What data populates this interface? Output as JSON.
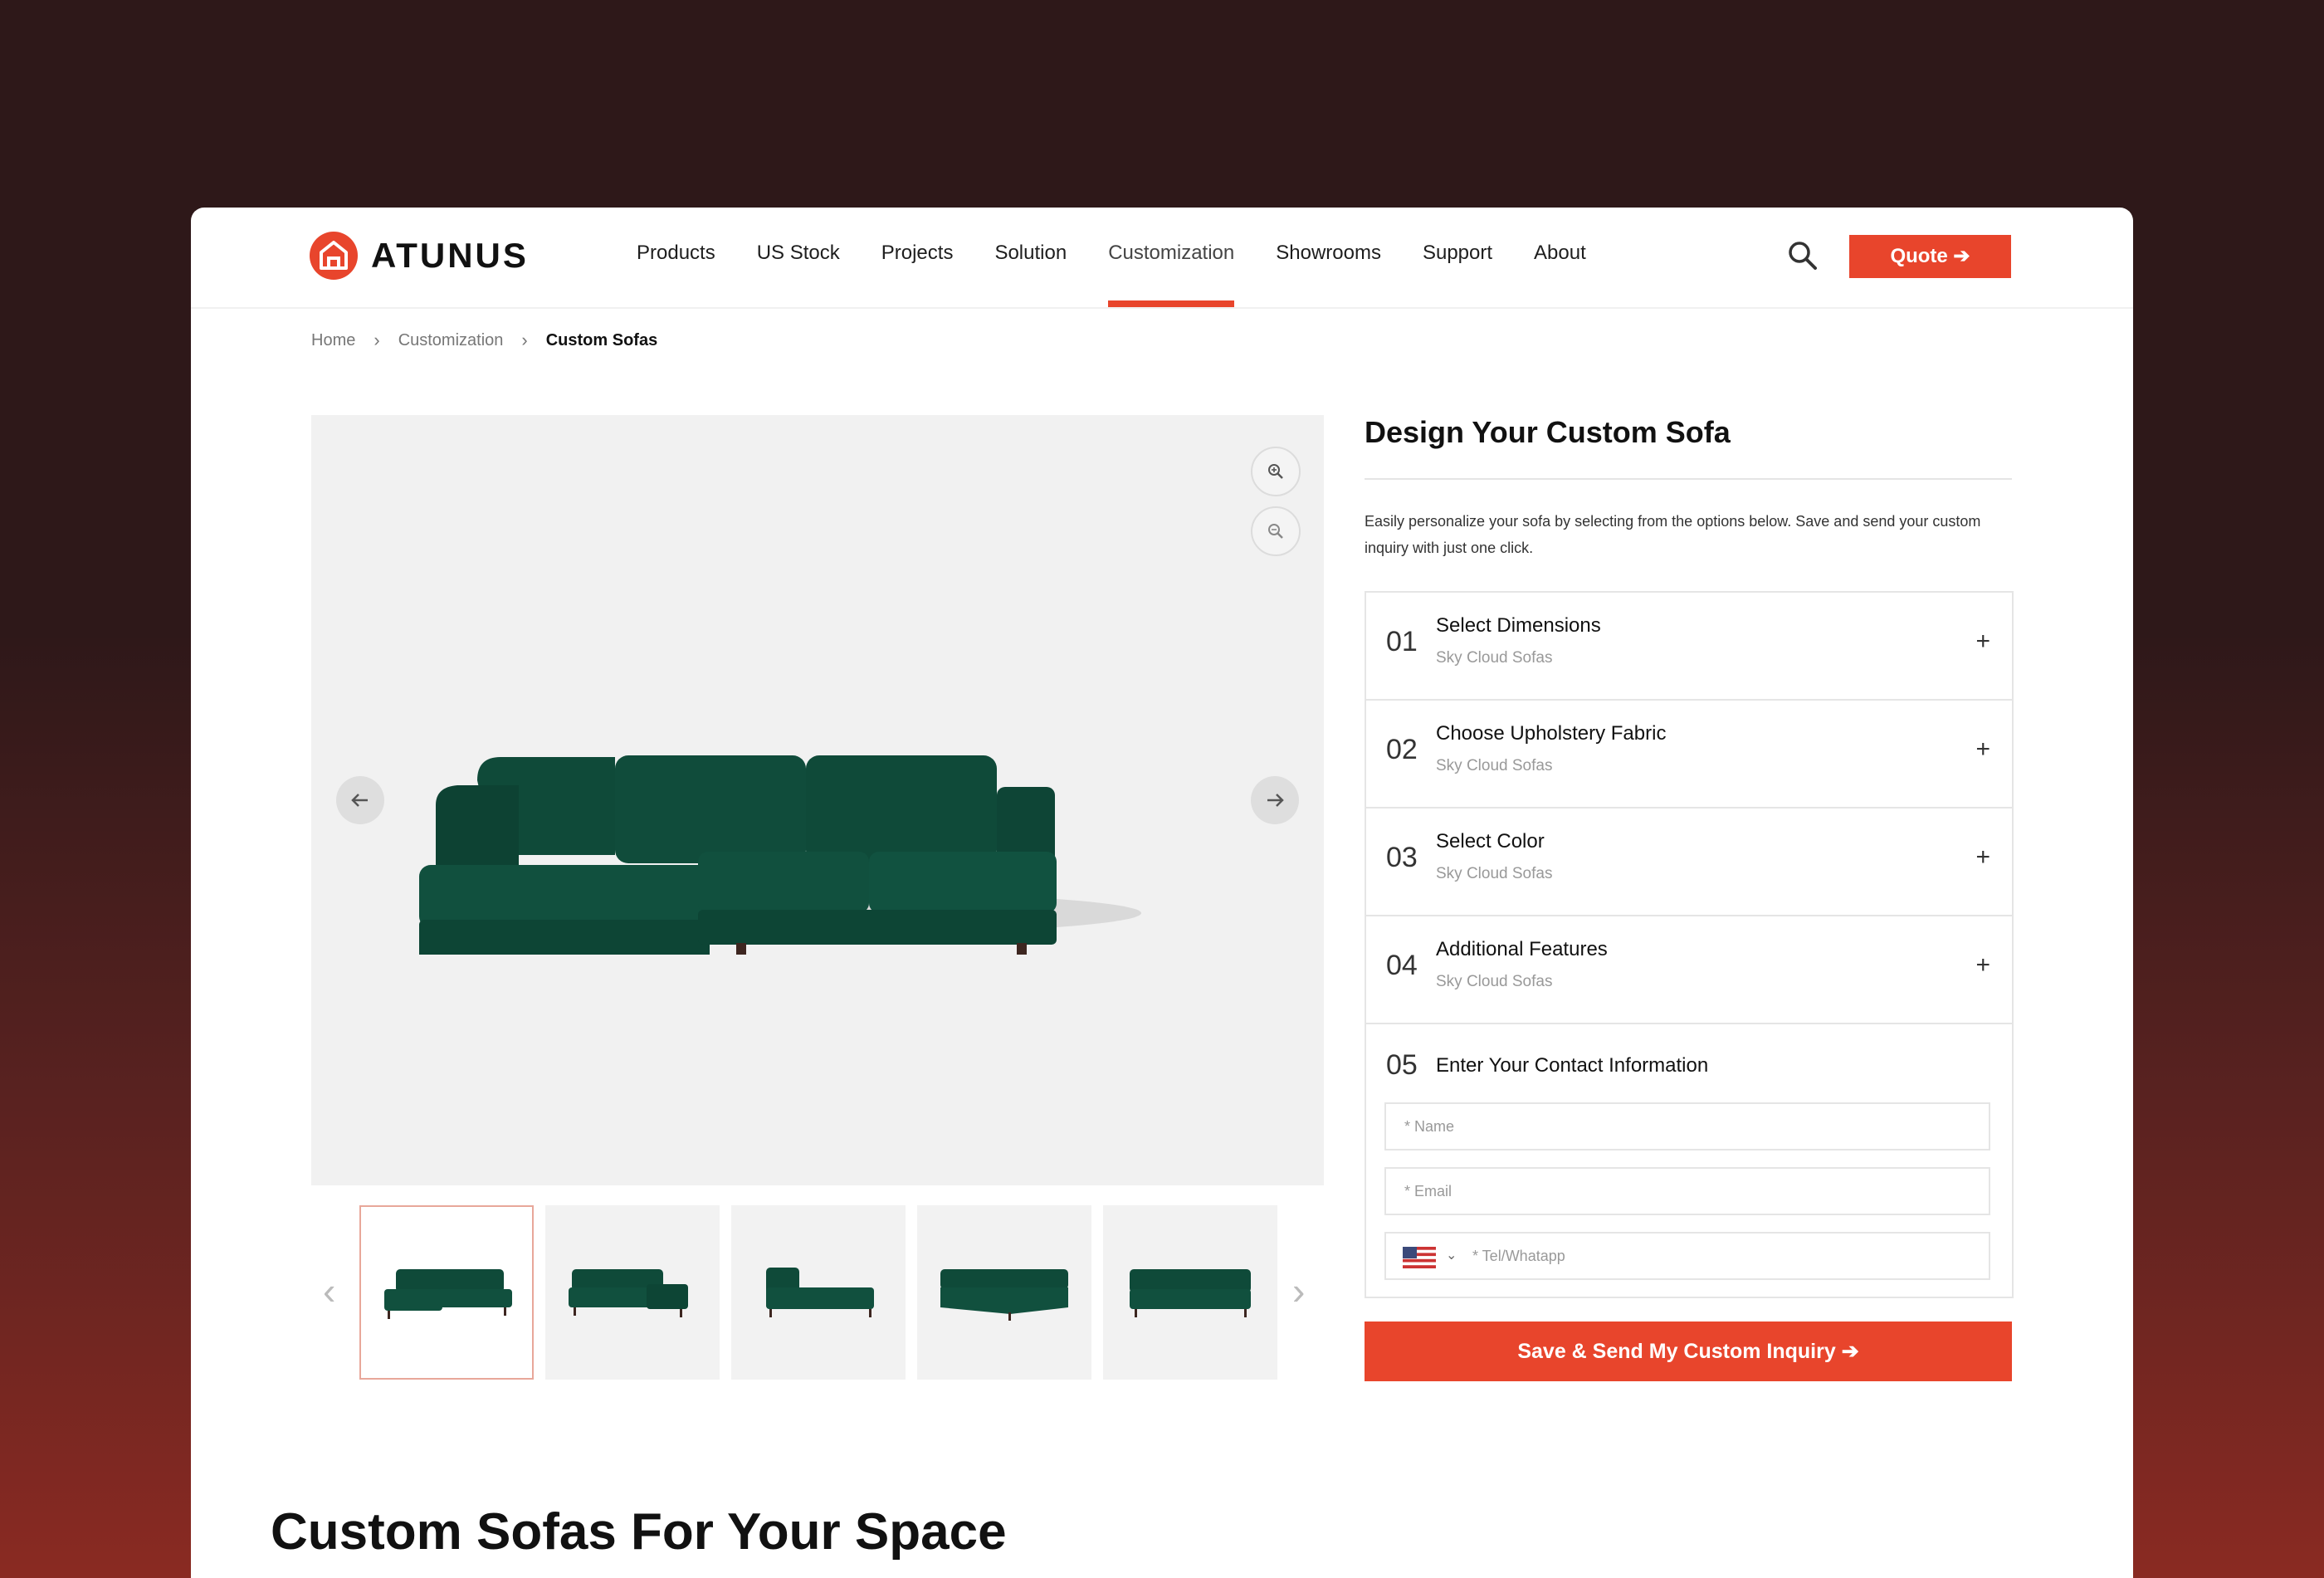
{
  "brand": {
    "name": "ATUNUS",
    "accent": "#e8452c"
  },
  "nav": {
    "items": [
      "Products",
      "US Stock",
      "Projects",
      "Solution",
      "Customization",
      "Showrooms",
      "Support",
      "About"
    ],
    "active": "Customization",
    "quote_label": "Quote ➔"
  },
  "breadcrumb": [
    "Home",
    "Customization",
    "Custom Sofas"
  ],
  "gallery": {
    "main_color": "#104a3a",
    "thumbnail_count": 5,
    "active_thumbnail": 1
  },
  "configurator": {
    "title": "Design Your Custom Sofa",
    "description": "Easily personalize your sofa by selecting from the options below. Save and send your custom inquiry with just one click.",
    "steps": [
      {
        "num": "01",
        "title": "Select Dimensions",
        "subtitle": "Sky Cloud Sofas"
      },
      {
        "num": "02",
        "title": "Choose Upholstery Fabric",
        "subtitle": "Sky Cloud Sofas"
      },
      {
        "num": "03",
        "title": "Select Color",
        "subtitle": "Sky Cloud Sofas"
      },
      {
        "num": "04",
        "title": "Additional Features",
        "subtitle": "Sky Cloud Sofas"
      }
    ],
    "contact": {
      "num": "05",
      "title": "Enter Your Contact Information",
      "name_placeholder": "* Name",
      "email_placeholder": "* Email",
      "tel_placeholder": "* Tel/Whatapp"
    },
    "submit_label": "Save & Send My Custom Inquiry ➔"
  },
  "section": {
    "title": "Custom Sofas For Your Space"
  }
}
